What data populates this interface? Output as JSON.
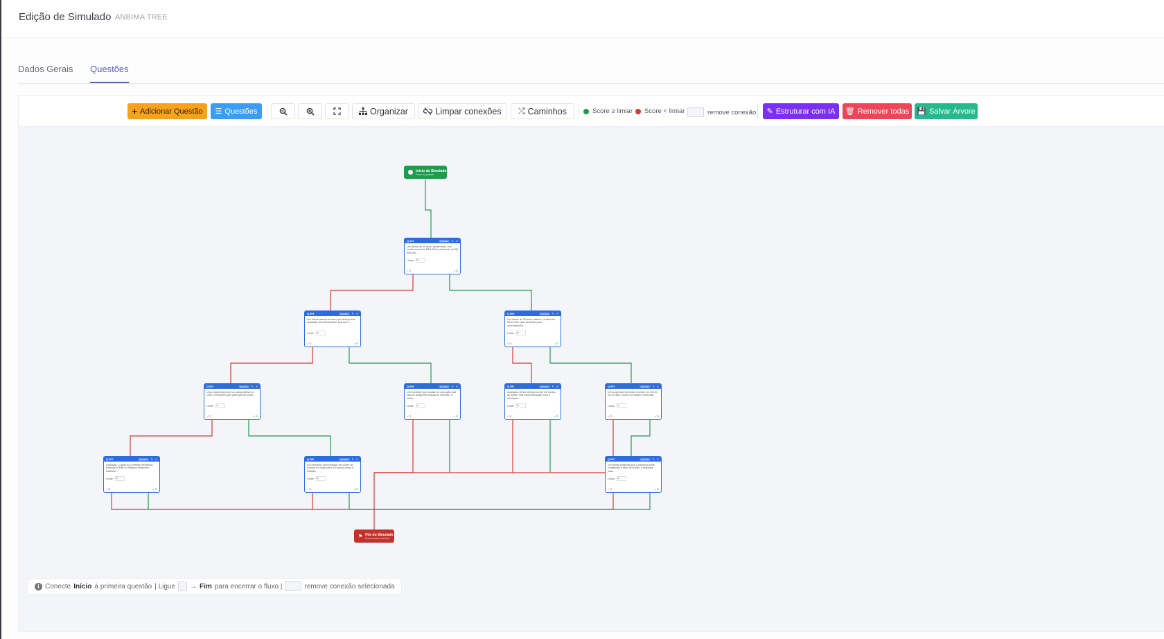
{
  "header": {
    "title": "Edição de Simulado",
    "subtitle": "ANBIMA TREE"
  },
  "tabs": [
    {
      "label": "Dados Gerais"
    },
    {
      "label": "Questões"
    }
  ],
  "toolbar": {
    "add_question": "Adicionar Questão",
    "questions": "Questões",
    "organize": "Organizar",
    "clear_connections": "Limpar conexões",
    "paths": "Caminhos",
    "legend_pass": "Score ≥ limiar",
    "legend_fail": "Score < limiar",
    "legend_remove": "remove conexão",
    "ai_structure": "Estruturar com IA",
    "remove_all": "Remover todas",
    "save_tree": "Salvar Árvore",
    "colors": {
      "pass": "#1f9b4e",
      "fail": "#d23b34",
      "accent": "#5b5fc7"
    }
  },
  "flow": {
    "start": {
      "title": "Início do Simulado",
      "subtitle": "Ponto de partida"
    },
    "end": {
      "title": "Fim do Simulado",
      "subtitle": "Encerramento do fluxo"
    },
    "nodes": [
      {
        "id": "Q 641",
        "tag": "Questão",
        "text": "Um cliente de 45 anos, aposentado, com renda mensal de R$ 8.000 e patrimônio de R$ 500.000...",
        "score_label": "Limiar",
        "score": "70"
      },
      {
        "id": "Q 893",
        "tag": "Questão",
        "text": "Um cliente avesso ao risco que deseja uma aplicação com alta liquidez para que o...",
        "score_label": "Limiar",
        "score": "70"
      },
      {
        "id": "Q 804",
        "tag": "Questão",
        "text": "Um cliente de 35 anos, solteiro, na faixa de R$ 10.000, quer acumular para aposentadoria...",
        "score_label": "Limiar",
        "score": "70"
      },
      {
        "id": "Q 922",
        "tag": "Questão",
        "text": "Uma empresa investe seu caixa público no CDB; o investidor quer participar do fundo...",
        "score_label": "Limiar",
        "score": "70"
      },
      {
        "id": "Q 458",
        "tag": "Questão",
        "text": "Um investidor quer avaliar se uma ação está cara ou barata em relação ao mercado. O índice...",
        "score_label": "Limiar",
        "score": "70"
      },
      {
        "id": "Q 651",
        "tag": "Questão",
        "text": "Avaliação: cliente deseja investir em fundos de ações, mas está preocupado com a tributação...",
        "score_label": "Limiar",
        "score": "70"
      },
      {
        "id": "Q 603",
        "tag": "Questão",
        "text": "Um cooperado investidor recebeu em CDI-DI em 30 dias e quer se proteger contra alta...",
        "score_label": "Limiar",
        "score": "70"
      },
      {
        "id": "Q 567",
        "tag": "Questão",
        "text": "Avaliação: o papel do Conselho Monetário Nacional (CMN) no Sistema Financeiro Nacional...",
        "score_label": "Limiar",
        "score": "70"
      },
      {
        "id": "Q 882",
        "tag": "Questão",
        "text": "Um investidor quer proteger seu poder de compra no longo prazo (10 anos) contra a inflação...",
        "score_label": "Limiar",
        "score": "70"
      },
      {
        "id": "Q 652",
        "tag": "Questão",
        "text": "Um cliente pergunta qual a diferença entre volatilidade e risco de crédito. A resposta mais...",
        "score_label": "Limiar",
        "score": "70"
      }
    ],
    "fail_label": "< 70",
    "pass_label": "≥ 70"
  },
  "hint": {
    "p1": "Conecte",
    "b1": "Início",
    "p2": "à primeira questão",
    "p3": "| Ligue",
    "b2": "Fim",
    "p4": "para encerrar o fluxo |",
    "p5": "remove conexão selecionada"
  }
}
